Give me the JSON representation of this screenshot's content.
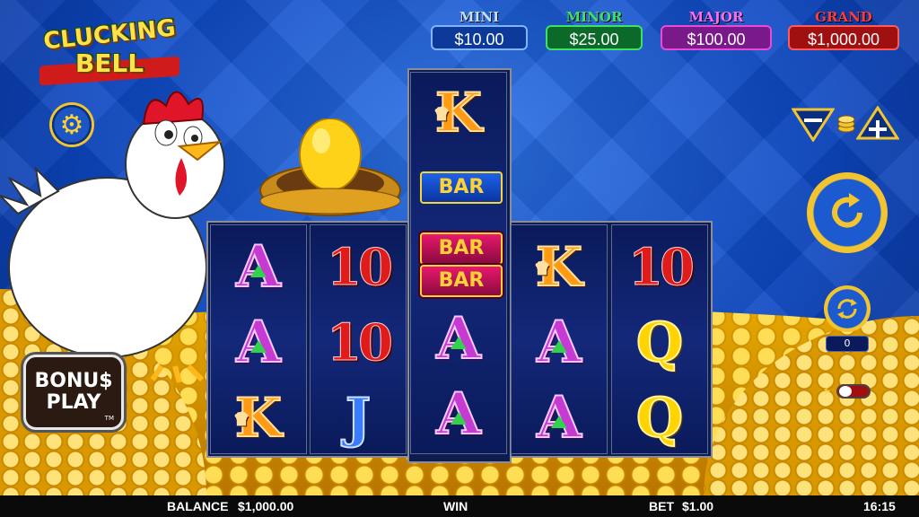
{
  "logo": {
    "line1": "CLUCKING",
    "line2": "BELL"
  },
  "jackpots": [
    {
      "label": "MINI",
      "value": "$10.00",
      "label_color": "#bfe0ff",
      "border": "#7fb4ff",
      "bg": "#0d3a9a"
    },
    {
      "label": "MINOR",
      "value": "$25.00",
      "label_color": "#3fe06a",
      "border": "#3fe06a",
      "bg": "#0b6a2a"
    },
    {
      "label": "MAJOR",
      "value": "$100.00",
      "label_color": "#ff6af0",
      "border": "#e84ad8",
      "bg": "#7a1a8a"
    },
    {
      "label": "GRAND",
      "value": "$1,000.00",
      "label_color": "#ff3a3a",
      "border": "#ff5a5a",
      "bg": "#a01010"
    }
  ],
  "reels": [
    [
      "A",
      "A",
      "K"
    ],
    [
      "10",
      "10",
      "J"
    ],
    [
      "K",
      "BAR",
      "BAR",
      "BAR",
      "A",
      "A"
    ],
    [
      "K",
      "A",
      "A"
    ],
    [
      "10",
      "Q",
      "Q"
    ]
  ],
  "bonus_play": {
    "line1": "BONU$",
    "line2": "PLAY",
    "tm": "TM"
  },
  "autoplay_count": "0",
  "bottom": {
    "balance_label": "BALANCE",
    "balance_value": "$1,000.00",
    "win_label": "WIN",
    "bet_label": "BET",
    "bet_value": "$1.00",
    "clock": "16:15"
  },
  "icons": {
    "settings": "gear-icon",
    "bet_decrease": "minus-icon",
    "bet_increase": "plus-icon",
    "spin": "spin-arrow-icon",
    "autoplay": "autoplay-icon",
    "turbo": "lightning-icon"
  }
}
